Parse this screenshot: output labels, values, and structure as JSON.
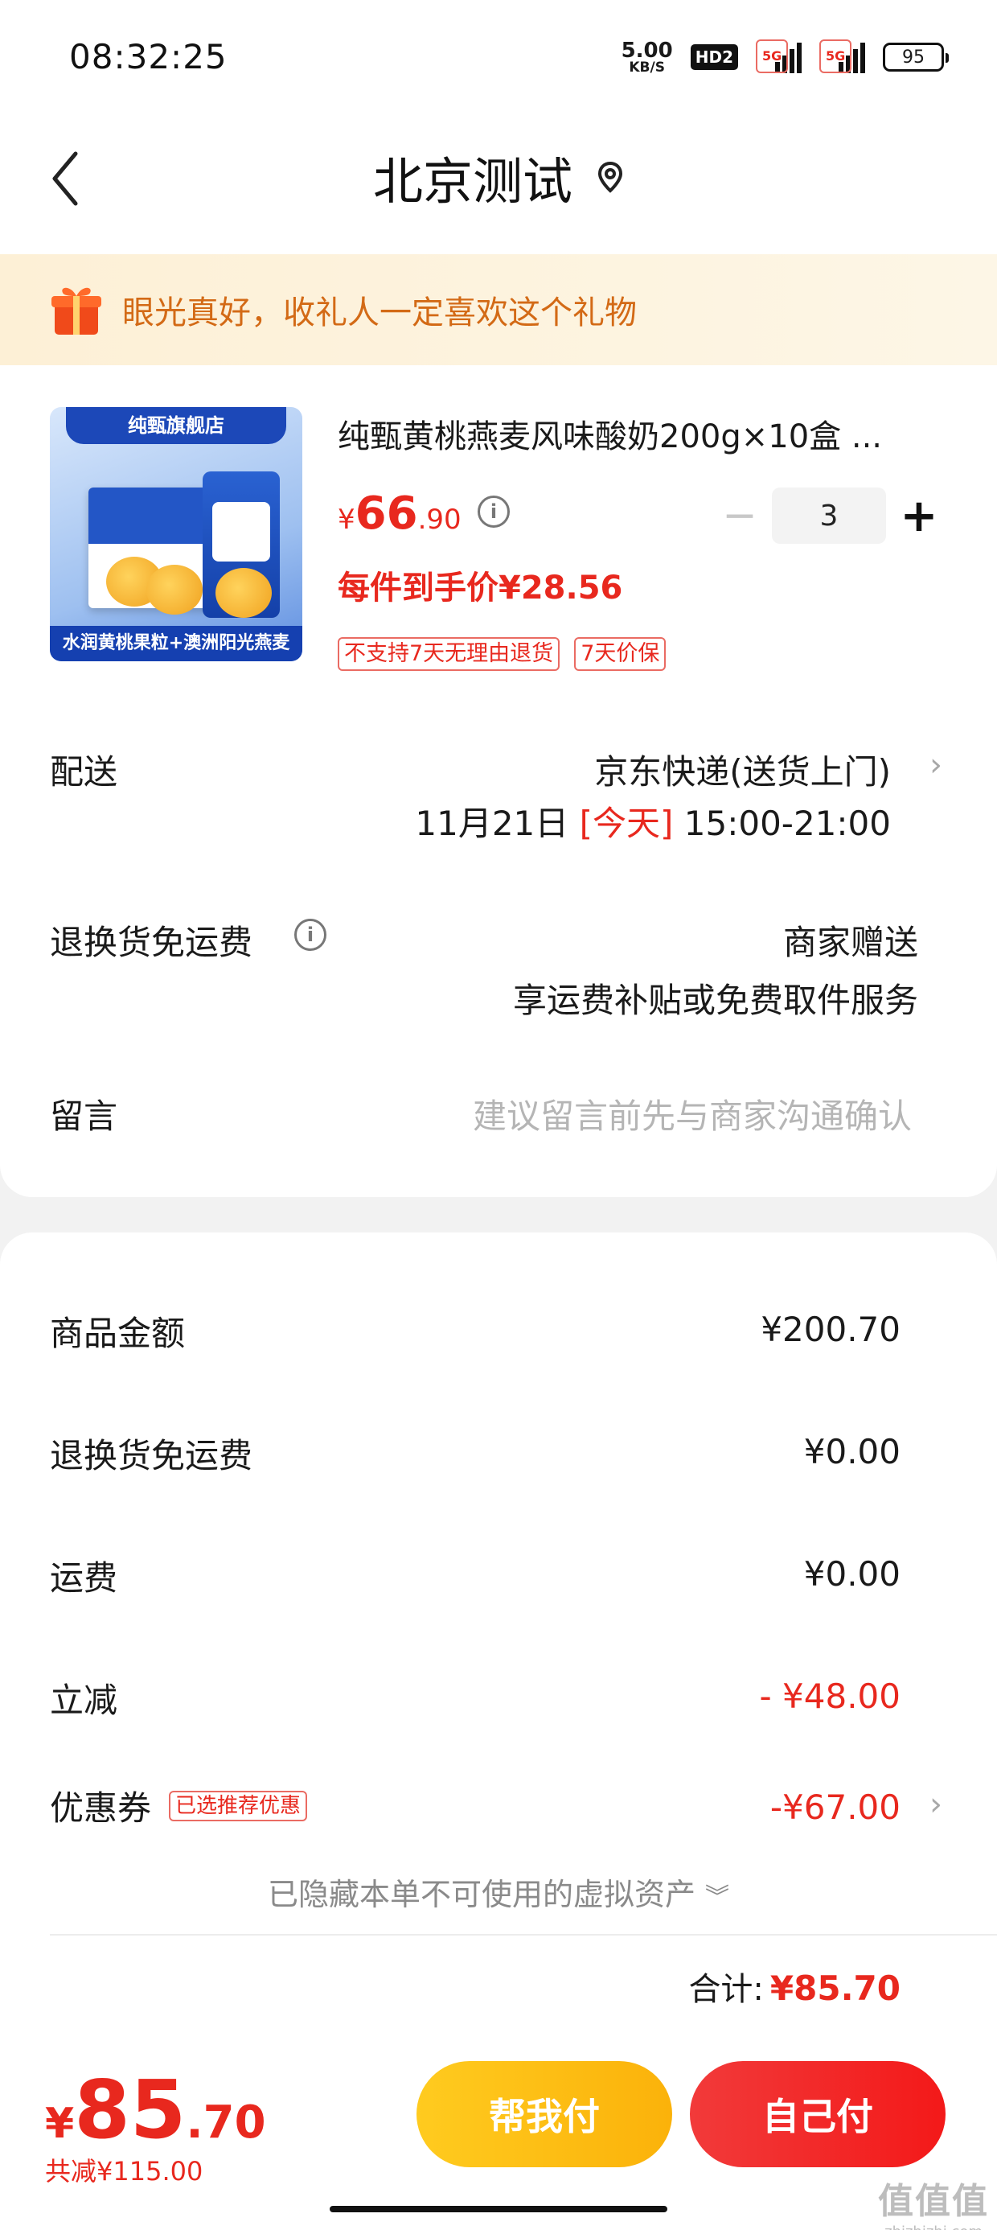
{
  "status_bar": {
    "time": "08:32:25",
    "net_speed": "5.00",
    "net_unit": "KB/S",
    "hd_label": "HD2",
    "sig1_label": "5G",
    "sig2_label": "5G",
    "battery": "95"
  },
  "header": {
    "title": "北京测试",
    "back_icon": "chevron-left-icon",
    "location_icon": "location-pin-icon"
  },
  "banner": {
    "text": "眼光真好，收礼人一定喜欢这个礼物",
    "icon": "gift-icon"
  },
  "product": {
    "name": "纯甄黄桃燕麦风味酸奶200g×10盒 ...",
    "image_top_text": "纯甄旗舰店",
    "image_bottom_text": "水润黄桃果粒+澳洲阳光燕麦",
    "price_symbol": "¥",
    "price_int": "66",
    "price_dec": ".90",
    "info_icon_label": "i",
    "quantity": "3",
    "minus_label": "−",
    "plus_label": "+",
    "unit_price": "每件到手价¥28.56",
    "tags": [
      "不支持7天无理由退货",
      "7天价保"
    ]
  },
  "delivery": {
    "label": "配送",
    "method": "京东快递(送货上门)",
    "date": "11月21日",
    "day": "[今天]",
    "time_slot": "15:00-21:00"
  },
  "return_shipping": {
    "label": "退换货免运费",
    "info_icon_label": "i",
    "value1": "商家赠送",
    "value2": "享运费补贴或免费取件服务"
  },
  "message": {
    "label": "留言",
    "placeholder": "建议留言前先与商家沟通确认"
  },
  "summary": {
    "goods_label": "商品金额",
    "goods_value": "¥200.70",
    "return_fee_label": "退换货免运费",
    "return_fee_value": "¥0.00",
    "shipping_label": "运费",
    "shipping_value": "¥0.00",
    "discount_label": "立减",
    "discount_value": "- ¥48.00",
    "coupon_label": "优惠券",
    "coupon_badge": "已选推荐优惠",
    "coupon_value": "-¥67.00",
    "hidden_assets": "已隐藏本单不可使用的虚拟资产",
    "total_label": "合计:",
    "total_value": "¥85.70"
  },
  "bottom": {
    "total_symbol": "¥",
    "total_int": "85",
    "total_dec": ".70",
    "total_reduce": "共减¥115.00",
    "help_pay": "帮我付",
    "self_pay": "自己付"
  },
  "watermark": {
    "line1": "值值值",
    "line2": "zhizhizhi.com"
  },
  "colors": {
    "accent_red": "#e8281e",
    "banner_orange": "#d36a16",
    "help_button": "#fbb20a",
    "self_button": "#f31919"
  }
}
